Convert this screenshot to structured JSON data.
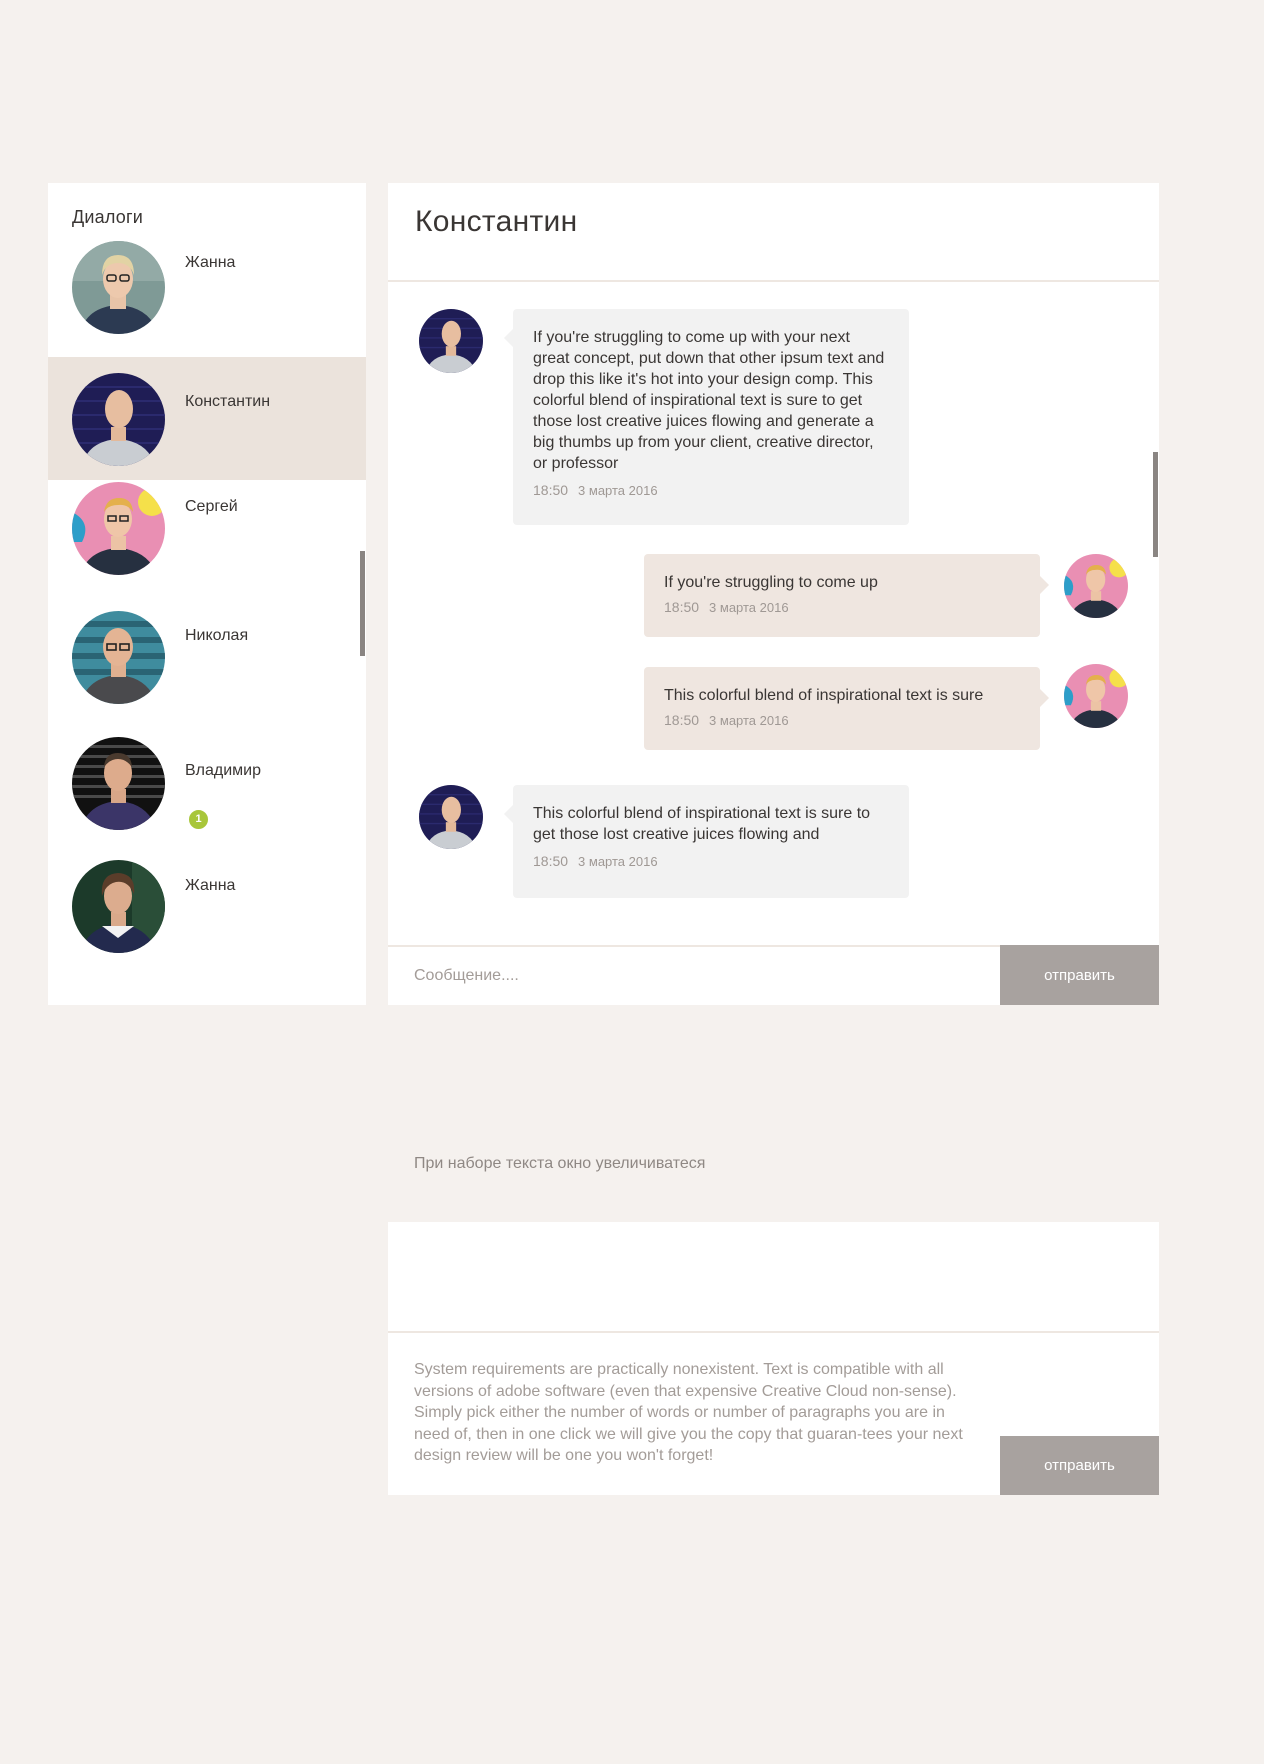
{
  "sidebar": {
    "title": "Диалоги",
    "items": [
      {
        "name": "Жанна",
        "active": false,
        "badge": null
      },
      {
        "name": "Константин",
        "active": true,
        "badge": null
      },
      {
        "name": "Сергей",
        "active": false,
        "badge": null
      },
      {
        "name": "Николая",
        "active": false,
        "badge": null
      },
      {
        "name": "Владимир",
        "active": false,
        "badge": "1"
      },
      {
        "name": "Жанна",
        "active": false,
        "badge": null
      }
    ]
  },
  "chat": {
    "title": "Константин",
    "messages": [
      {
        "direction": "incoming",
        "text": "If you're struggling to come up with your next great concept, put down that other ipsum text and drop this like it's hot into your design comp. This colorful blend of inspirational text is sure to get those lost creative juices flowing and generate a big thumbs up from your client, creative director, or professor",
        "time": "18:50",
        "date": "3 марта 2016"
      },
      {
        "direction": "outgoing",
        "text": "If you're struggling to come up",
        "time": "18:50",
        "date": "3 марта 2016"
      },
      {
        "direction": "outgoing",
        "text": "This colorful blend of inspirational text is sure",
        "time": "18:50",
        "date": "3 марта 2016"
      },
      {
        "direction": "incoming",
        "text": "This colorful blend of inspirational text is sure to get those lost creative juices flowing and",
        "time": "18:50",
        "date": "3 марта 2016"
      }
    ],
    "composer": {
      "placeholder": "Сообщение....",
      "send_label": "отправить"
    }
  },
  "note": "При наборе текста окно увеличиватеся",
  "demo": {
    "text": "System requirements are practically nonexistent. Text is compatible with all versions of adobe software (even that expensive Creative Cloud non-sense). Simply pick either the number of words or number of paragraphs you are in need of, then in one click we will give you the copy that guaran-tees your next design review will be one you won't forget!",
    "send_label": "отправить"
  },
  "colors": {
    "background": "#f5f1ee",
    "active_item": "#ebe3dc",
    "incoming_bubble": "#f2f2f2",
    "outgoing_bubble": "#efe6e0",
    "send_button": "#a8a29f",
    "badge": "#a8c63a"
  }
}
